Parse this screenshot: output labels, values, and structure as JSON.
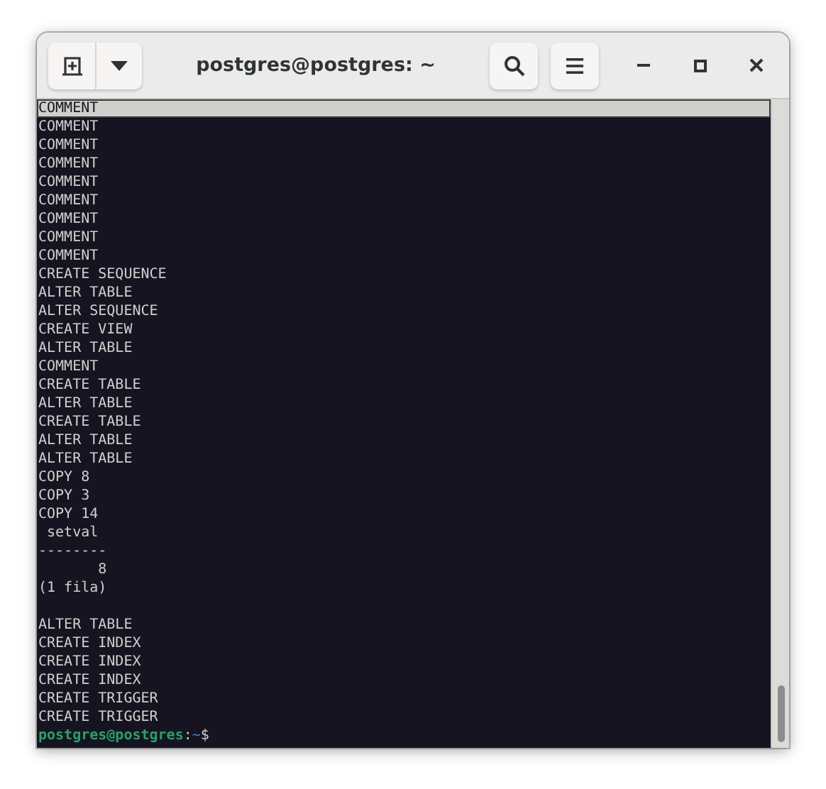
{
  "window": {
    "title": "postgres@postgres: ~"
  },
  "lines": [
    {
      "text": "COMMENT",
      "highlighted": true
    },
    {
      "text": "COMMENT",
      "highlighted": false
    },
    {
      "text": "COMMENT",
      "highlighted": false
    },
    {
      "text": "COMMENT",
      "highlighted": false
    },
    {
      "text": "COMMENT",
      "highlighted": false
    },
    {
      "text": "COMMENT",
      "highlighted": false
    },
    {
      "text": "COMMENT",
      "highlighted": false
    },
    {
      "text": "COMMENT",
      "highlighted": false
    },
    {
      "text": "COMMENT",
      "highlighted": false
    },
    {
      "text": "CREATE SEQUENCE",
      "highlighted": false
    },
    {
      "text": "ALTER TABLE",
      "highlighted": false
    },
    {
      "text": "ALTER SEQUENCE",
      "highlighted": false
    },
    {
      "text": "CREATE VIEW",
      "highlighted": false
    },
    {
      "text": "ALTER TABLE",
      "highlighted": false
    },
    {
      "text": "COMMENT",
      "highlighted": false
    },
    {
      "text": "CREATE TABLE",
      "highlighted": false
    },
    {
      "text": "ALTER TABLE",
      "highlighted": false
    },
    {
      "text": "CREATE TABLE",
      "highlighted": false
    },
    {
      "text": "ALTER TABLE",
      "highlighted": false
    },
    {
      "text": "ALTER TABLE",
      "highlighted": false
    },
    {
      "text": "COPY 8",
      "highlighted": false
    },
    {
      "text": "COPY 3",
      "highlighted": false
    },
    {
      "text": "COPY 14",
      "highlighted": false
    },
    {
      "text": " setval",
      "highlighted": false
    },
    {
      "text": "--------",
      "highlighted": false
    },
    {
      "text": "       8",
      "highlighted": false
    },
    {
      "text": "(1 fila)",
      "highlighted": false
    },
    {
      "highlighted": false
    },
    {
      "text": "ALTER TABLE",
      "highlighted": false
    },
    {
      "text": "CREATE INDEX",
      "highlighted": false
    },
    {
      "text": "CREATE INDEX",
      "highlighted": false
    },
    {
      "text": "CREATE INDEX",
      "highlighted": false
    },
    {
      "text": "CREATE TRIGGER",
      "highlighted": false
    },
    {
      "text": "CREATE TRIGGER",
      "highlighted": false
    }
  ],
  "prompt": {
    "user_host": "postgres@postgres",
    "separator": ":",
    "path": "~",
    "symbol": "$"
  }
}
